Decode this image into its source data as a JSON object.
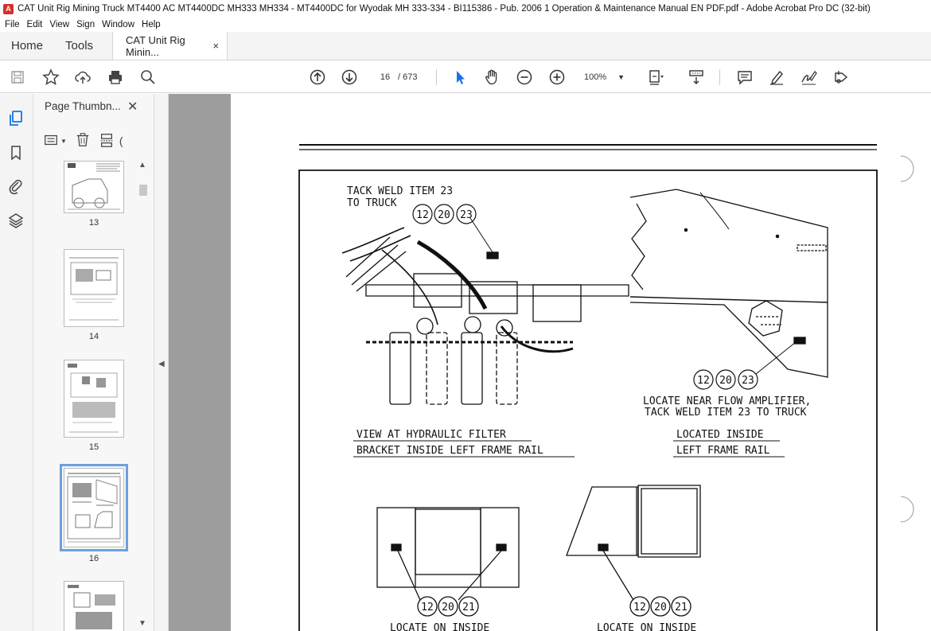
{
  "window": {
    "title": "CAT Unit Rig Mining Truck MT4400 AC MT4400DC MH333 MH334 - MT4400DC for Wyodak MH 333-334 - BI115386 - Pub. 2006 1 Operation & Maintenance Manual EN PDF.pdf - Adobe Acrobat Pro DC (32-bit)"
  },
  "menu": [
    "File",
    "Edit",
    "View",
    "Sign",
    "Window",
    "Help"
  ],
  "tabs": {
    "home": "Home",
    "tools": "Tools",
    "document": "CAT Unit Rig Minin...",
    "close": "×"
  },
  "toolbar": {
    "current_page": "16",
    "total_pages": "/ 673",
    "zoom": "100%"
  },
  "thumbnail_panel": {
    "title": "Page Thumbn...",
    "pages": [
      {
        "label": "13"
      },
      {
        "label": "14"
      },
      {
        "label": "15"
      },
      {
        "label": "16",
        "selected": true
      },
      {
        "label": ""
      }
    ]
  },
  "document_page": {
    "callout_tack_weld_line1": "TACK WELD ITEM 23",
    "callout_tack_weld_line2": "TO TRUCK",
    "bubble_12": "12",
    "bubble_20": "20",
    "bubble_21": "21",
    "bubble_23": "23",
    "caption_filter_line1": "VIEW AT HYDRAULIC FILTER",
    "caption_filter_line2": "BRACKET INSIDE LEFT FRAME RAIL",
    "callout_flow_line1": "LOCATE NEAR FLOW AMPLIFIER,",
    "callout_flow_line2": "TACK WELD ITEM 23 TO TRUCK",
    "caption_rail_line1": "LOCATED INSIDE",
    "caption_rail_line2": "LEFT FRAME RAIL",
    "caption_bottom_left": "LOCATE ON INSIDE",
    "caption_bottom_right": "LOCATE ON INSIDE"
  },
  "colors": {
    "accent_blue": "#1473e6",
    "viewer_gray": "#9d9d9d",
    "app_red": "#d4302b"
  }
}
